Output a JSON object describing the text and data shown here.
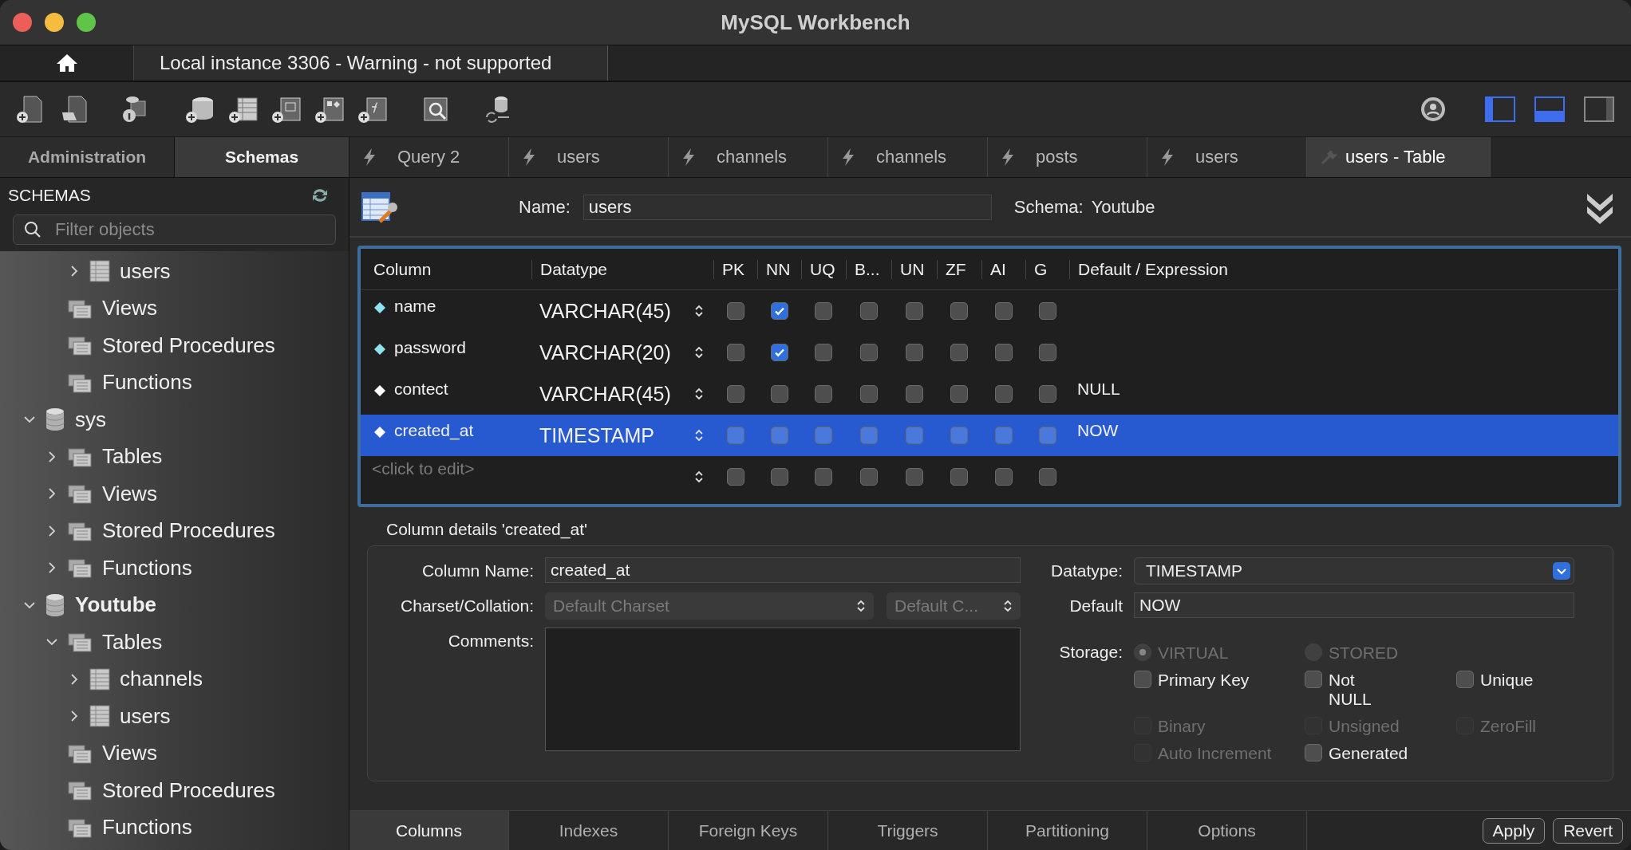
{
  "window": {
    "title": "MySQL Workbench"
  },
  "connection_tab": {
    "label": "Local instance 3306 - Warning - not supported"
  },
  "layout_toggles": [
    {
      "on": true
    },
    {
      "on": true
    },
    {
      "on": false
    }
  ],
  "sidebar": {
    "tabs": [
      {
        "label": "Administration",
        "selected": false
      },
      {
        "label": "Schemas",
        "selected": true
      }
    ],
    "header": "SCHEMAS",
    "filter": {
      "placeholder": "Filter objects"
    },
    "tree": [
      {
        "children": [
          {
            "children": [
              {
                "label": "users",
                "kind": "table",
                "expanded": false
              }
            ]
          },
          {
            "label": "Views",
            "kind": "folder"
          },
          {
            "label": "Stored Procedures",
            "kind": "folder"
          },
          {
            "label": "Functions",
            "kind": "folder"
          }
        ]
      },
      {
        "label": "sys",
        "kind": "schema",
        "default": false,
        "expanded": true,
        "children": [
          {
            "label": "Tables",
            "kind": "folder",
            "expanded": false
          },
          {
            "label": "Views",
            "kind": "folder",
            "expanded": false
          },
          {
            "label": "Stored Procedures",
            "kind": "folder",
            "expanded": false
          },
          {
            "label": "Functions",
            "kind": "folder",
            "expanded": false
          }
        ]
      },
      {
        "label": "Youtube",
        "kind": "schema",
        "default": true,
        "expanded": true,
        "children": [
          {
            "label": "Tables",
            "kind": "folder",
            "expanded": true,
            "children": [
              {
                "label": "channels",
                "kind": "table",
                "expanded": false
              },
              {
                "label": "users",
                "kind": "table",
                "expanded": false
              }
            ]
          },
          {
            "label": "Views",
            "kind": "folder"
          },
          {
            "label": "Stored Procedures",
            "kind": "folder"
          },
          {
            "label": "Functions",
            "kind": "folder"
          }
        ]
      }
    ]
  },
  "editor_tabs": [
    {
      "label": "Query 2",
      "kind": "query",
      "selected": false
    },
    {
      "label": "users",
      "kind": "query",
      "selected": false
    },
    {
      "label": "channels",
      "kind": "query",
      "selected": false
    },
    {
      "label": "channels",
      "kind": "query",
      "selected": false
    },
    {
      "label": "posts",
      "kind": "query",
      "selected": false
    },
    {
      "label": "users",
      "kind": "query",
      "selected": false
    },
    {
      "label": "users - Table",
      "kind": "table",
      "selected": true
    }
  ],
  "table_header": {
    "name_label": "Name:",
    "name_value": "users",
    "schema_label": "Schema:",
    "schema_value": "Youtube"
  },
  "columns_grid": {
    "columns": [
      "Column",
      "Datatype",
      "PK",
      "NN",
      "UQ",
      "B...",
      "UN",
      "ZF",
      "AI",
      "G",
      "Default / Expression"
    ],
    "rows": [
      {
        "kind": "column",
        "name": "name",
        "datatype": "VARCHAR(45)",
        "flags": [
          false,
          true,
          false,
          false,
          false,
          false,
          false,
          false
        ],
        "default": "",
        "selected": false
      },
      {
        "kind": "column",
        "name": "password",
        "datatype": "VARCHAR(20)",
        "flags": [
          false,
          true,
          false,
          false,
          false,
          false,
          false,
          false
        ],
        "default": "",
        "selected": false
      },
      {
        "kind": "column",
        "name": "contect",
        "datatype": "VARCHAR(45)",
        "flags": [
          false,
          false,
          false,
          false,
          false,
          false,
          false,
          false
        ],
        "default": "NULL",
        "selected": false
      },
      {
        "kind": "column",
        "name": "created_at",
        "datatype": "TIMESTAMP",
        "flags": [
          false,
          false,
          false,
          false,
          false,
          false,
          false,
          false
        ],
        "default": "NOW",
        "selected": true
      },
      {
        "kind": "placeholder",
        "name": "<click to edit>",
        "flags": [
          false,
          false,
          false,
          false,
          false,
          false,
          false,
          false
        ],
        "selected": false
      }
    ]
  },
  "column_details": {
    "title": "Column details 'created_at'",
    "column_name": {
      "label": "Column Name:",
      "value": "created_at"
    },
    "charset": {
      "label": "Charset/Collation:",
      "charset": "Default Charset",
      "collation": "Default C..."
    },
    "comments": {
      "label": "Comments:"
    },
    "datatype": {
      "label": "Datatype:",
      "value": "TIMESTAMP"
    },
    "default": {
      "label": "Default",
      "value": "NOW"
    },
    "storage": {
      "label": "Storage:",
      "options": [
        {
          "label": "VIRTUAL",
          "selected": true
        },
        {
          "label": "STORED",
          "selected": false
        }
      ],
      "disabled": true
    },
    "flags": [
      {
        "label": "Primary Key",
        "checked": false,
        "disabled": false
      },
      {
        "label": "Not NULL",
        "checked": false,
        "disabled": false
      },
      {
        "label": "Unique",
        "checked": false,
        "disabled": false
      },
      {
        "label": "Binary",
        "checked": false,
        "disabled": true
      },
      {
        "label": "Unsigned",
        "checked": false,
        "disabled": true
      },
      {
        "label": "ZeroFill",
        "checked": false,
        "disabled": true
      },
      {
        "label": "Auto Increment",
        "checked": false,
        "disabled": true
      },
      {
        "label": "Generated",
        "checked": false,
        "disabled": false
      }
    ]
  },
  "bottom_tabs": [
    {
      "label": "Columns",
      "selected": true
    },
    {
      "label": "Indexes",
      "selected": false
    },
    {
      "label": "Foreign Keys",
      "selected": false
    },
    {
      "label": "Triggers",
      "selected": false
    },
    {
      "label": "Partitioning",
      "selected": false
    },
    {
      "label": "Options",
      "selected": false
    }
  ],
  "buttons": [
    "Apply",
    "Revert"
  ]
}
